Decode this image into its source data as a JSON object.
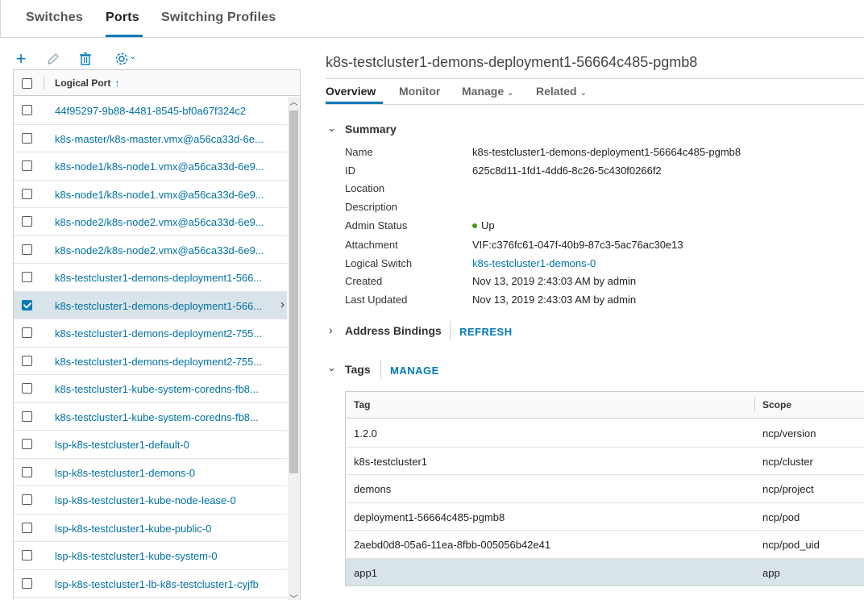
{
  "top_tabs": {
    "switches": "Switches",
    "ports": "Ports",
    "switching_profiles": "Switching Profiles"
  },
  "toolbar": {
    "add": "+",
    "edit": "✎",
    "delete": "🗑",
    "settings": "⚙",
    "settings_caret": "⌄"
  },
  "list": {
    "header_label": "Logical Port",
    "sort_indicator": "↑",
    "rows": [
      {
        "label": "44f95297-9b88-4481-8545-bf0a67f324c2",
        "checked": false
      },
      {
        "label": "k8s-master/k8s-master.vmx@a56ca33d-6e...",
        "checked": false
      },
      {
        "label": "k8s-node1/k8s-node1.vmx@a56ca33d-6e9...",
        "checked": false
      },
      {
        "label": "k8s-node1/k8s-node1.vmx@a56ca33d-6e9...",
        "checked": false
      },
      {
        "label": "k8s-node2/k8s-node2.vmx@a56ca33d-6e9...",
        "checked": false
      },
      {
        "label": "k8s-node2/k8s-node2.vmx@a56ca33d-6e9...",
        "checked": false
      },
      {
        "label": "k8s-testcluster1-demons-deployment1-566...",
        "checked": false
      },
      {
        "label": "k8s-testcluster1-demons-deployment1-566...",
        "checked": true
      },
      {
        "label": "k8s-testcluster1-demons-deployment2-755...",
        "checked": false
      },
      {
        "label": "k8s-testcluster1-demons-deployment2-755...",
        "checked": false
      },
      {
        "label": "k8s-testcluster1-kube-system-coredns-fb8...",
        "checked": false
      },
      {
        "label": "k8s-testcluster1-kube-system-coredns-fb8...",
        "checked": false
      },
      {
        "label": "lsp-k8s-testcluster1-default-0",
        "checked": false
      },
      {
        "label": "lsp-k8s-testcluster1-demons-0",
        "checked": false
      },
      {
        "label": "lsp-k8s-testcluster1-kube-node-lease-0",
        "checked": false
      },
      {
        "label": "lsp-k8s-testcluster1-kube-public-0",
        "checked": false
      },
      {
        "label": "lsp-k8s-testcluster1-kube-system-0",
        "checked": false
      },
      {
        "label": "lsp-k8s-testcluster1-lb-k8s-testcluster1-cyjfb",
        "checked": false
      }
    ]
  },
  "detail": {
    "title": "k8s-testcluster1-demons-deployment1-56664c485-pgmb8",
    "tabs": {
      "overview": "Overview",
      "monitor": "Monitor",
      "manage": "Manage",
      "related": "Related"
    },
    "summary": {
      "title": "Summary",
      "labels": {
        "name": "Name",
        "id": "ID",
        "location": "Location",
        "description": "Description",
        "admin_status": "Admin Status",
        "attachment": "Attachment",
        "logical_switch": "Logical Switch",
        "created": "Created",
        "last_updated": "Last Updated"
      },
      "values": {
        "name": "k8s-testcluster1-demons-deployment1-56664c485-pgmb8",
        "id": "625c8d11-1fd1-4dd6-8c26-5c430f0266f2",
        "location": "",
        "description": "",
        "admin_status": "Up",
        "attachment": "VIF:c376fc61-047f-40b9-87c3-5ac76ac30e13",
        "logical_switch": "k8s-testcluster1-demons-0",
        "created": "Nov 13, 2019 2:43:03 AM by admin",
        "last_updated": "Nov 13, 2019 2:43:03 AM by admin"
      },
      "status_color": "#48960c"
    },
    "address_bindings": {
      "title": "Address Bindings",
      "action": "REFRESH"
    },
    "tags": {
      "title": "Tags",
      "action": "MANAGE",
      "columns": {
        "tag": "Tag",
        "scope": "Scope"
      },
      "rows": [
        {
          "tag": "1.2.0",
          "scope": "ncp/version"
        },
        {
          "tag": "k8s-testcluster1",
          "scope": "ncp/cluster"
        },
        {
          "tag": "demons",
          "scope": "ncp/project"
        },
        {
          "tag": "deployment1-56664c485-pgmb8",
          "scope": "ncp/pod"
        },
        {
          "tag": "2aebd0d8-05a6-11ea-8fbb-005056b42e41",
          "scope": "ncp/pod_uid"
        },
        {
          "tag": "app1",
          "scope": "app"
        }
      ]
    }
  },
  "colors": {
    "accent": "#0079b8",
    "link": "#0072a3",
    "selected_row": "#d9e4ea"
  }
}
